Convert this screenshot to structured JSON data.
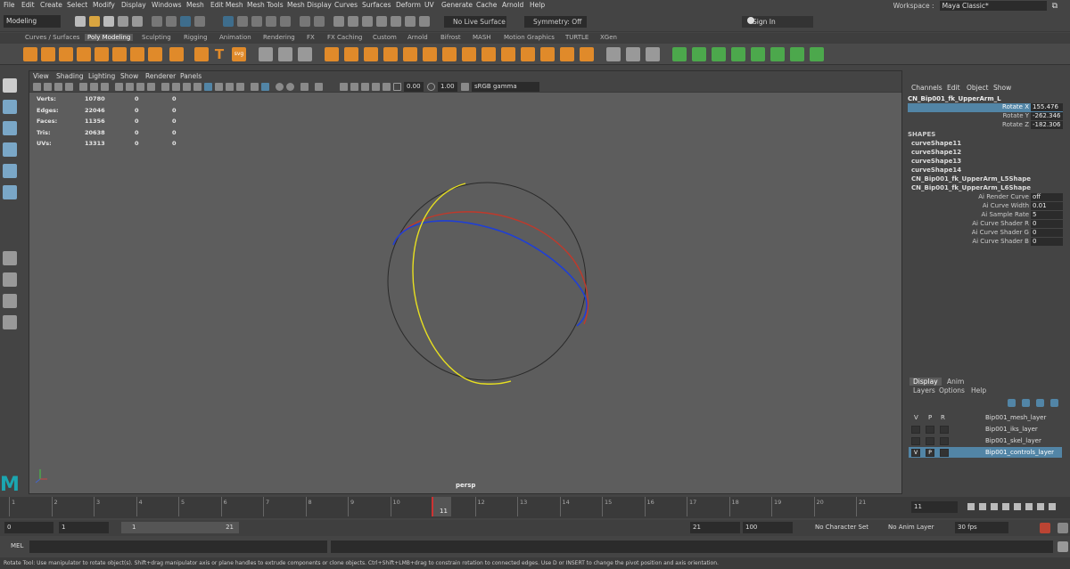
{
  "menubar": {
    "items": [
      "File",
      "Edit",
      "Create",
      "Select",
      "Modify",
      "Display",
      "Windows",
      "Mesh",
      "Edit Mesh",
      "Mesh Tools",
      "Mesh Display",
      "Curves",
      "Surfaces",
      "Deform",
      "UV",
      "Generate",
      "Cache",
      "Arnold",
      "Help"
    ],
    "workspace_label": "Workspace :",
    "workspace_value": "Maya Classic*"
  },
  "statusline": {
    "mode": "Modeling",
    "live_surface": "No Live Surface",
    "symmetry": "Symmetry: Off",
    "sign_in": "Sign In"
  },
  "shelf": {
    "tabs": [
      "Curves / Surfaces",
      "Poly Modeling",
      "Sculpting",
      "Rigging",
      "Animation",
      "Rendering",
      "FX",
      "FX Caching",
      "Custom",
      "Arnold",
      "Bifrost",
      "MASH",
      "Motion Graphics",
      "TURTLE",
      "XGen"
    ],
    "active_tab": "Poly Modeling",
    "text_tool": "T",
    "svg_tool": "svg"
  },
  "viewport": {
    "menu": [
      "View",
      "Shading",
      "Lighting",
      "Show",
      "Renderer",
      "Panels"
    ],
    "exposure": "0.00",
    "gamma": "1.00",
    "color_space": "sRGB gamma",
    "camera_label": "persp",
    "hud": [
      {
        "label": "Verts:",
        "v1": "10780",
        "v2": "0",
        "v3": "0"
      },
      {
        "label": "Edges:",
        "v1": "22046",
        "v2": "0",
        "v3": "0"
      },
      {
        "label": "Faces:",
        "v1": "11356",
        "v2": "0",
        "v3": "0"
      },
      {
        "label": "Tris:",
        "v1": "20638",
        "v2": "0",
        "v3": "0"
      },
      {
        "label": "UVs:",
        "v1": "13313",
        "v2": "0",
        "v3": "0"
      }
    ]
  },
  "channel_box": {
    "menu": [
      "Channels",
      "Edit",
      "Object",
      "Show"
    ],
    "object": "CN_Bip001_fk_UpperArm_L",
    "attributes": [
      {
        "label": "Rotate X",
        "value": "155.476"
      },
      {
        "label": "Rotate Y",
        "value": "-262.346"
      },
      {
        "label": "Rotate Z",
        "value": "-182.306"
      }
    ],
    "shapes_header": "SHAPES",
    "shapes": [
      "curveShape11",
      "curveShape12",
      "curveShape13",
      "curveShape14",
      "CN_Bip001_fk_UpperArm_L5Shape",
      "CN_Bip001_fk_UpperArm_L6Shape"
    ],
    "shape_attrs": [
      {
        "label": "Ai Render Curve",
        "value": "off"
      },
      {
        "label": "Ai Curve Width",
        "value": "0.01"
      },
      {
        "label": "Ai Sample Rate",
        "value": "5"
      },
      {
        "label": "Ai Curve Shader R",
        "value": "0"
      },
      {
        "label": "Ai Curve Shader G",
        "value": "0"
      },
      {
        "label": "Ai Curve Shader B",
        "value": "0"
      }
    ]
  },
  "layer_editor": {
    "tabs": [
      "Display",
      "Anim"
    ],
    "menu": [
      "Layers",
      "Options",
      "Help"
    ],
    "header": [
      "V",
      "P",
      "R"
    ],
    "layers": [
      {
        "name": "Bip001_mesh_layer",
        "v": "",
        "p": ""
      },
      {
        "name": "Bip001_iks_layer",
        "v": "",
        "p": ""
      },
      {
        "name": "Bip001_skel_layer",
        "v": "",
        "p": ""
      },
      {
        "name": "Bip001_controls_layer",
        "v": "V",
        "p": "P"
      }
    ]
  },
  "timeline": {
    "ticks": [
      "1",
      "2",
      "3",
      "4",
      "5",
      "6",
      "7",
      "8",
      "9",
      "10",
      "11",
      "12",
      "13",
      "14",
      "15",
      "16",
      "17",
      "18",
      "19",
      "20",
      "21"
    ],
    "current_frame": "11"
  },
  "range": {
    "start": "0",
    "anim_start": "1",
    "slider_start": "1",
    "slider_end": "21",
    "end": "21",
    "anim_end": "100",
    "character_set": "No Character Set",
    "anim_layer": "No Anim Layer",
    "fps": "30 fps"
  },
  "command": {
    "label": "MEL"
  },
  "help_line": "Rotate Tool: Use manipulator to rotate object(s). Shift+drag manipulator axis or plane handles to extrude components or clone objects. Ctrl+Shift+LMB+drag to constrain rotation to connected edges. Use D or INSERT to change the pivot position and axis orientation.",
  "colors": {
    "accent": "#5285a6",
    "maya_teal": "#1ba6b0",
    "curve_red": "#c0392b",
    "curve_blue": "#1f3fd6",
    "curve_yellow": "#e8e020"
  }
}
